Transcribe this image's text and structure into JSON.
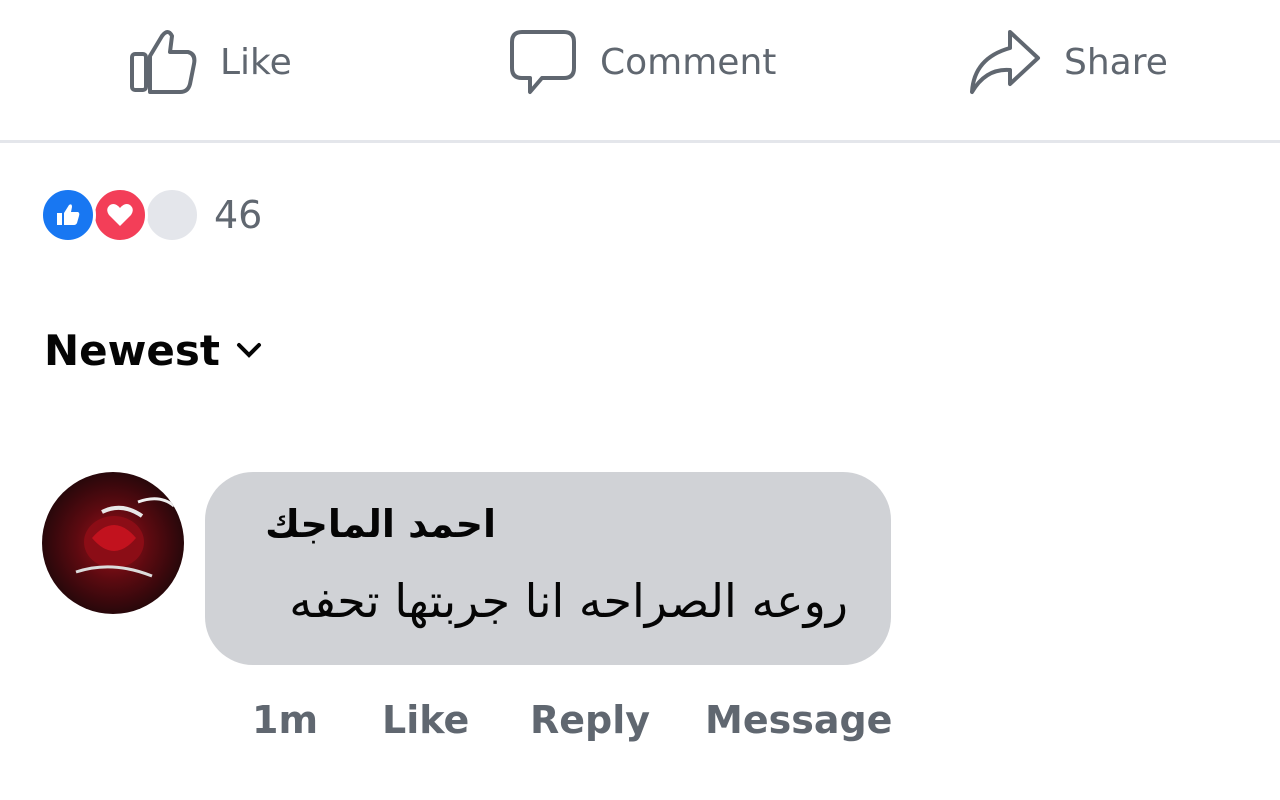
{
  "actions": {
    "like_label": "Like",
    "comment_label": "Comment",
    "share_label": "Share"
  },
  "reactions": {
    "types": [
      "like",
      "love",
      "other"
    ],
    "count": "46"
  },
  "sort": {
    "label": "Newest"
  },
  "comment": {
    "author": "احمد الماجك",
    "text": "روعه الصراحه انا جربتها تحفه",
    "time": "1m",
    "like_label": "Like",
    "reply_label": "Reply",
    "message_label": "Message"
  },
  "colors": {
    "text_secondary": "#606770",
    "text_primary": "#050505",
    "bubble": "#d0d2d6",
    "like_blue": "#1877f2",
    "love_red": "#f33e58"
  }
}
